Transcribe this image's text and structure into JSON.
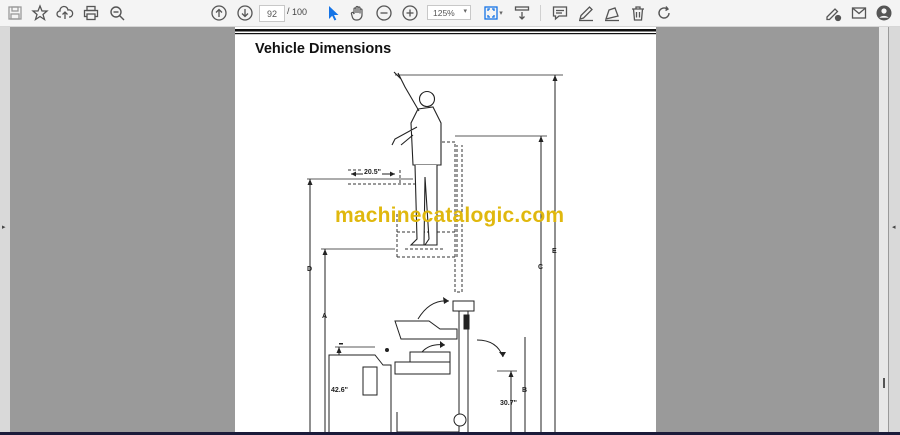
{
  "toolbar": {
    "page_current": "92",
    "page_separator": "/",
    "page_total": "100",
    "zoom_value": "125%"
  },
  "document": {
    "heading": "Vehicle Dimensions",
    "watermark": "machinecatalogic.com",
    "dim_labels": {
      "width_top": "20.5\"",
      "d": "D",
      "c": "C",
      "e": "E",
      "a": "A",
      "b": "B",
      "h1": "42.6\"",
      "h2": "30.7\""
    }
  }
}
